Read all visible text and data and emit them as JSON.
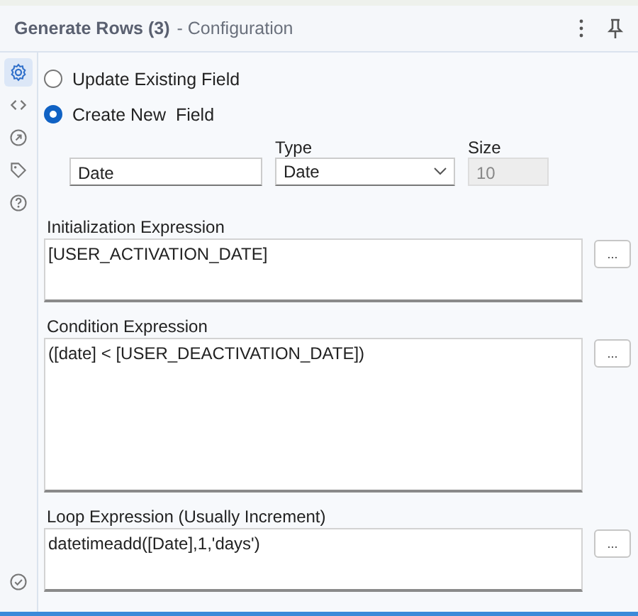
{
  "header": {
    "title": "Generate Rows (3)",
    "subtitle": "- Configuration"
  },
  "sidebar": {
    "items": [
      {
        "kind": "gear",
        "selected": true
      },
      {
        "kind": "code",
        "selected": false
      },
      {
        "kind": "arrow-circle",
        "selected": false
      },
      {
        "kind": "tag",
        "selected": false
      },
      {
        "kind": "help",
        "selected": false
      }
    ],
    "footer": [
      {
        "kind": "check-circle",
        "selected": false
      }
    ]
  },
  "mode_options": [
    {
      "label": "Update Existing Field",
      "selected": false
    },
    {
      "label": "Create New  Field",
      "selected": true
    }
  ],
  "field": {
    "name": "Date",
    "type_label": "Type",
    "type": "Date",
    "size_label": "Size",
    "size": "10",
    "size_disabled": true
  },
  "expressions": [
    {
      "label": "Initialization Expression",
      "value": "[USER_ACTIVATION_DATE]",
      "button": "..."
    },
    {
      "label": "Condition Expression",
      "value": "([date] < [USER_DEACTIVATION_DATE])",
      "button": "..."
    },
    {
      "label": "Loop Expression (Usually Increment)",
      "value": "datetimeadd([Date],1,'days')",
      "button": "..."
    }
  ]
}
